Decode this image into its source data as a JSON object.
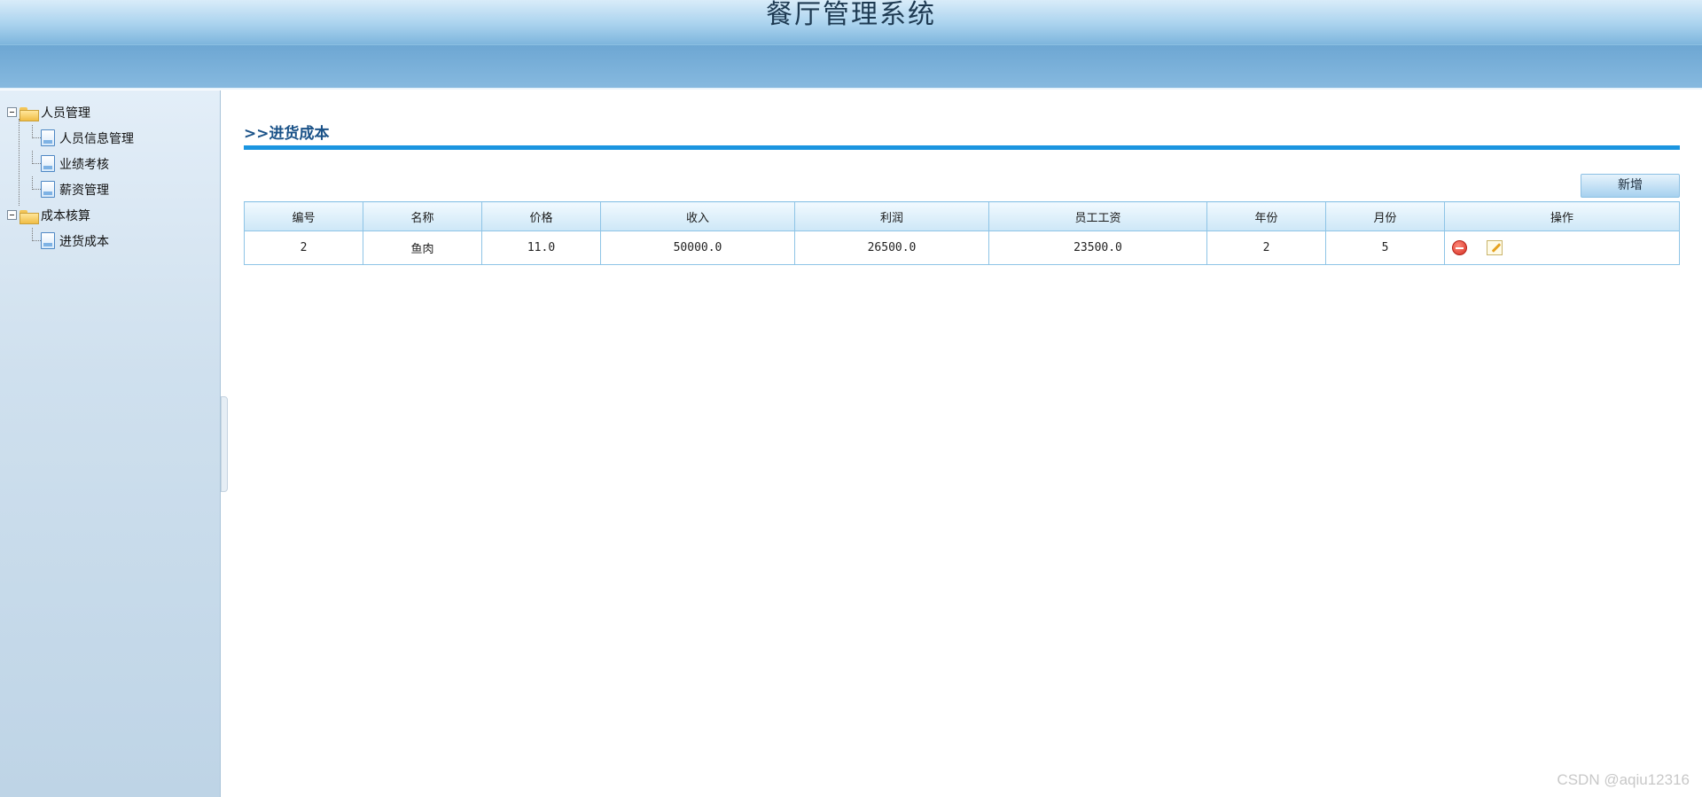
{
  "header": {
    "title": "餐厅管理系统"
  },
  "sidebar": {
    "groups": [
      {
        "label": "人员管理",
        "items": [
          {
            "label": "人员信息管理"
          },
          {
            "label": "业绩考核"
          },
          {
            "label": "薪资管理"
          }
        ]
      },
      {
        "label": "成本核算",
        "items": [
          {
            "label": "进货成本"
          }
        ]
      }
    ]
  },
  "main": {
    "breadcrumb": ">>进货成本",
    "add_button": "新增",
    "table": {
      "columns": [
        "编号",
        "名称",
        "价格",
        "收入",
        "利润",
        "员工工资",
        "年份",
        "月份",
        "操作"
      ],
      "rows": [
        [
          "2",
          "鱼肉",
          "11.0",
          "50000.0",
          "26500.0",
          "23500.0",
          "2",
          "5"
        ]
      ]
    }
  },
  "watermark": "CSDN @aqiu12316",
  "icons": [
    "minus-toggle-icon",
    "folder-icon",
    "page-icon",
    "delete-icon",
    "edit-icon"
  ]
}
